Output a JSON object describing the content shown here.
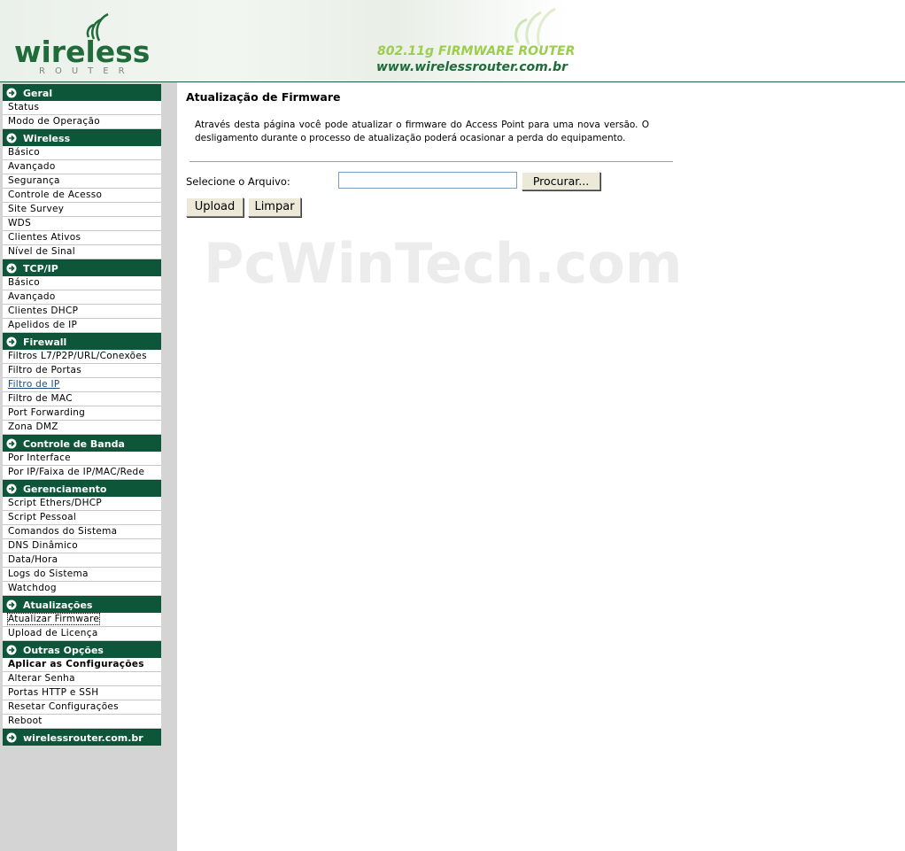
{
  "header": {
    "logo_text": "wireless",
    "logo_sub": "ROUTER",
    "product": "802.11g FIRMWARE ROUTER",
    "site": "www.wirelessrouter.com.br"
  },
  "sidebar": {
    "sections": [
      {
        "title": "Geral",
        "items": [
          "Status",
          "Modo de Operação"
        ]
      },
      {
        "title": "Wireless",
        "items": [
          "Básico",
          "Avançado",
          "Segurança",
          "Controle de Acesso",
          "Site Survey",
          "WDS",
          "Clientes Ativos",
          "Nível de Sinal"
        ]
      },
      {
        "title": "TCP/IP",
        "items": [
          "Básico",
          "Avançado",
          "Clientes DHCP",
          "Apelidos de IP"
        ]
      },
      {
        "title": "Firewall",
        "items": [
          "Filtros L7/P2P/URL/Conexões",
          "Filtro de Portas",
          "Filtro de IP",
          "Filtro de MAC",
          "Port Forwarding",
          "Zona DMZ"
        ]
      },
      {
        "title": "Controle de Banda",
        "items": [
          "Por Interface",
          "Por IP/Faixa de IP/MAC/Rede"
        ]
      },
      {
        "title": "Gerenciamento",
        "items": [
          "Script Ethers/DHCP",
          "Script Pessoal",
          "Comandos do Sistema",
          "DNS Dinâmico",
          "Data/Hora",
          "Logs do Sistema",
          "Watchdog"
        ]
      },
      {
        "title": "Atualizações",
        "items": [
          "Atualizar Firmware",
          "Upload de Licença"
        ]
      },
      {
        "title": "Outras Opções",
        "items": [
          "Aplicar as Configurações",
          "Alterar Senha",
          "Portas HTTP e SSH",
          "Resetar Configurações",
          "Reboot"
        ]
      },
      {
        "title": "wirelessrouter.com.br",
        "items": []
      }
    ]
  },
  "main": {
    "title": "Atualização de Firmware",
    "description": "Através desta página você pode atualizar o firmware do Access Point para uma nova versão. O desligamento durante o processo de atualização poderá ocasionar a perda do equipamento.",
    "file_label": "Selecione o Arquivo:",
    "file_value": "",
    "browse_label": "Procurar...",
    "upload_label": "Upload",
    "clear_label": "Limpar",
    "watermark": "PcWinTech.com"
  },
  "colors": {
    "section_bg": "#0e5639",
    "sidebar_bg": "#d4d4d4",
    "brand_green": "#1f6b3a",
    "brand_light": "#9ccd4e"
  }
}
